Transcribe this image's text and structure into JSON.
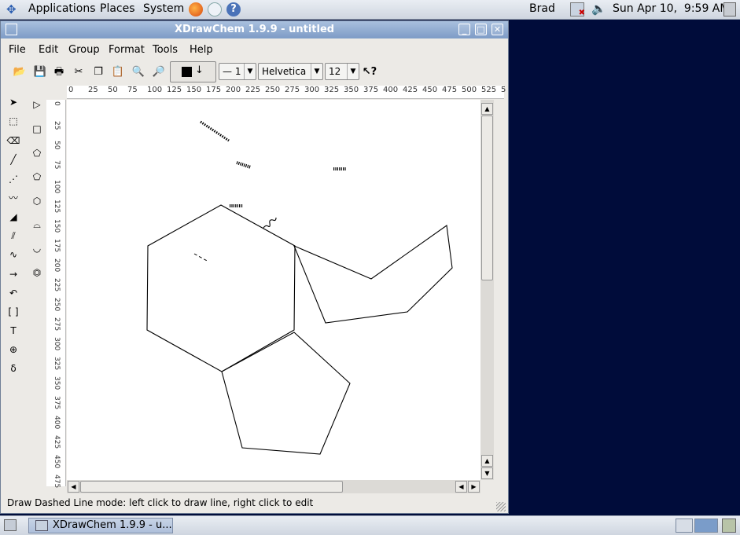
{
  "top_panel": {
    "menus": [
      "Applications",
      "Places",
      "System"
    ],
    "user": "Brad",
    "clock": "Sun Apr 10,  9:59 AM"
  },
  "window": {
    "title": "XDrawChem 1.9.9 - untitled",
    "menu": [
      "File",
      "Edit",
      "Group",
      "Format",
      "Tools",
      "Help"
    ],
    "toolbar": {
      "line_width": "— 1",
      "font": "Helvetica",
      "font_size": "12"
    },
    "hruler_labels": [
      "0",
      "25",
      "50",
      "75",
      "100",
      "125",
      "150",
      "175",
      "200",
      "225",
      "250",
      "275",
      "300",
      "325",
      "350",
      "375",
      "400",
      "425",
      "450",
      "475",
      "500",
      "525",
      "5"
    ],
    "vruler_labels": [
      "0",
      "25",
      "50",
      "75",
      "100",
      "125",
      "150",
      "175",
      "200",
      "225",
      "250",
      "275",
      "300",
      "325",
      "350",
      "375",
      "400",
      "425",
      "450",
      "475"
    ],
    "status": "Draw Dashed Line mode: left click to draw line, right click to edit"
  },
  "taskbar": {
    "task_label": "XDrawChem 1.9.9 - u..."
  },
  "colors": {
    "desktop": "#000c3a",
    "titlebar": "#8aa6cf",
    "panel": "#dfe4eb"
  }
}
